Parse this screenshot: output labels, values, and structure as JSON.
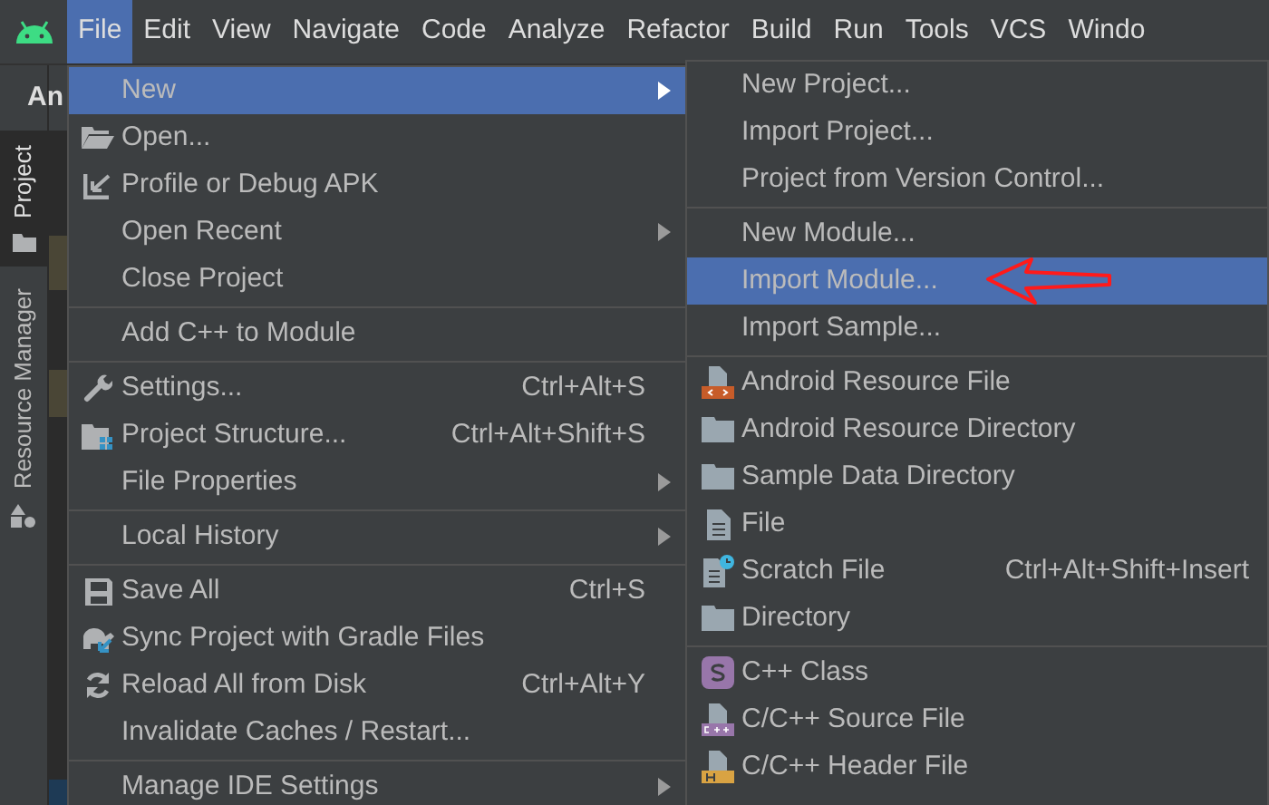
{
  "menubar": [
    {
      "label": "File",
      "selected": true
    },
    {
      "label": "Edit",
      "selected": false
    },
    {
      "label": "View",
      "selected": false
    },
    {
      "label": "Navigate",
      "selected": false
    },
    {
      "label": "Code",
      "selected": false
    },
    {
      "label": "Analyze",
      "selected": false
    },
    {
      "label": "Refactor",
      "selected": false
    },
    {
      "label": "Build",
      "selected": false
    },
    {
      "label": "Run",
      "selected": false
    },
    {
      "label": "Tools",
      "selected": false
    },
    {
      "label": "VCS",
      "selected": false
    },
    {
      "label": "Windo",
      "selected": false
    }
  ],
  "toolbar_text": "An",
  "tool_window_tabs": [
    {
      "label": "Project",
      "selected": true
    },
    {
      "label": "Resource Manager",
      "selected": false
    }
  ],
  "file_menu": [
    {
      "kind": "item",
      "label": "New",
      "submenu": true,
      "selected": true
    },
    {
      "kind": "item",
      "label": "Open...",
      "submenu": false,
      "selected": false
    },
    {
      "kind": "item",
      "label": "Profile or Debug APK",
      "submenu": false,
      "selected": false
    },
    {
      "kind": "item",
      "label": "Open Recent",
      "submenu": true,
      "selected": false
    },
    {
      "kind": "item",
      "label": "Close Project",
      "submenu": false,
      "selected": false
    },
    {
      "kind": "separator"
    },
    {
      "kind": "item",
      "label": "Add C++ to Module",
      "submenu": false,
      "selected": false
    },
    {
      "kind": "separator"
    },
    {
      "kind": "item",
      "label": "Settings...",
      "shortcut": "Ctrl+Alt+S",
      "submenu": false,
      "selected": false
    },
    {
      "kind": "item",
      "label": "Project Structure...",
      "shortcut": "Ctrl+Alt+Shift+S",
      "submenu": false,
      "selected": false
    },
    {
      "kind": "item",
      "label": "File Properties",
      "submenu": true,
      "selected": false
    },
    {
      "kind": "separator"
    },
    {
      "kind": "item",
      "label": "Local History",
      "submenu": true,
      "selected": false
    },
    {
      "kind": "separator"
    },
    {
      "kind": "item",
      "label": "Save All",
      "shortcut": "Ctrl+S",
      "submenu": false,
      "selected": false
    },
    {
      "kind": "item",
      "label": "Sync Project with Gradle Files",
      "submenu": false,
      "selected": false
    },
    {
      "kind": "item",
      "label": "Reload All from Disk",
      "shortcut": "Ctrl+Alt+Y",
      "submenu": false,
      "selected": false
    },
    {
      "kind": "item",
      "label": "Invalidate Caches / Restart...",
      "submenu": false,
      "selected": false
    },
    {
      "kind": "separator"
    },
    {
      "kind": "item",
      "label": "Manage IDE Settings",
      "submenu": true,
      "selected": false
    }
  ],
  "new_submenu": [
    {
      "kind": "item",
      "label": "New Project...",
      "selected": false
    },
    {
      "kind": "item",
      "label": "Import Project...",
      "selected": false
    },
    {
      "kind": "item",
      "label": "Project from Version Control...",
      "selected": false
    },
    {
      "kind": "separator"
    },
    {
      "kind": "item",
      "label": "New Module...",
      "selected": false
    },
    {
      "kind": "item",
      "label": "Import Module...",
      "selected": true
    },
    {
      "kind": "item",
      "label": "Import Sample...",
      "selected": false
    },
    {
      "kind": "separator"
    },
    {
      "kind": "item",
      "label": "Android Resource File",
      "selected": false
    },
    {
      "kind": "item",
      "label": "Android Resource Directory",
      "selected": false
    },
    {
      "kind": "item",
      "label": "Sample Data Directory",
      "selected": false
    },
    {
      "kind": "item",
      "label": "File",
      "selected": false
    },
    {
      "kind": "item",
      "label": "Scratch File",
      "shortcut": "Ctrl+Alt+Shift+Insert",
      "selected": false
    },
    {
      "kind": "item",
      "label": "Directory",
      "selected": false
    },
    {
      "kind": "separator"
    },
    {
      "kind": "item",
      "label": "C++ Class",
      "selected": false
    },
    {
      "kind": "item",
      "label": "C/C++ Source File",
      "selected": false
    },
    {
      "kind": "item",
      "label": "C/C++ Header File",
      "selected": false
    }
  ]
}
